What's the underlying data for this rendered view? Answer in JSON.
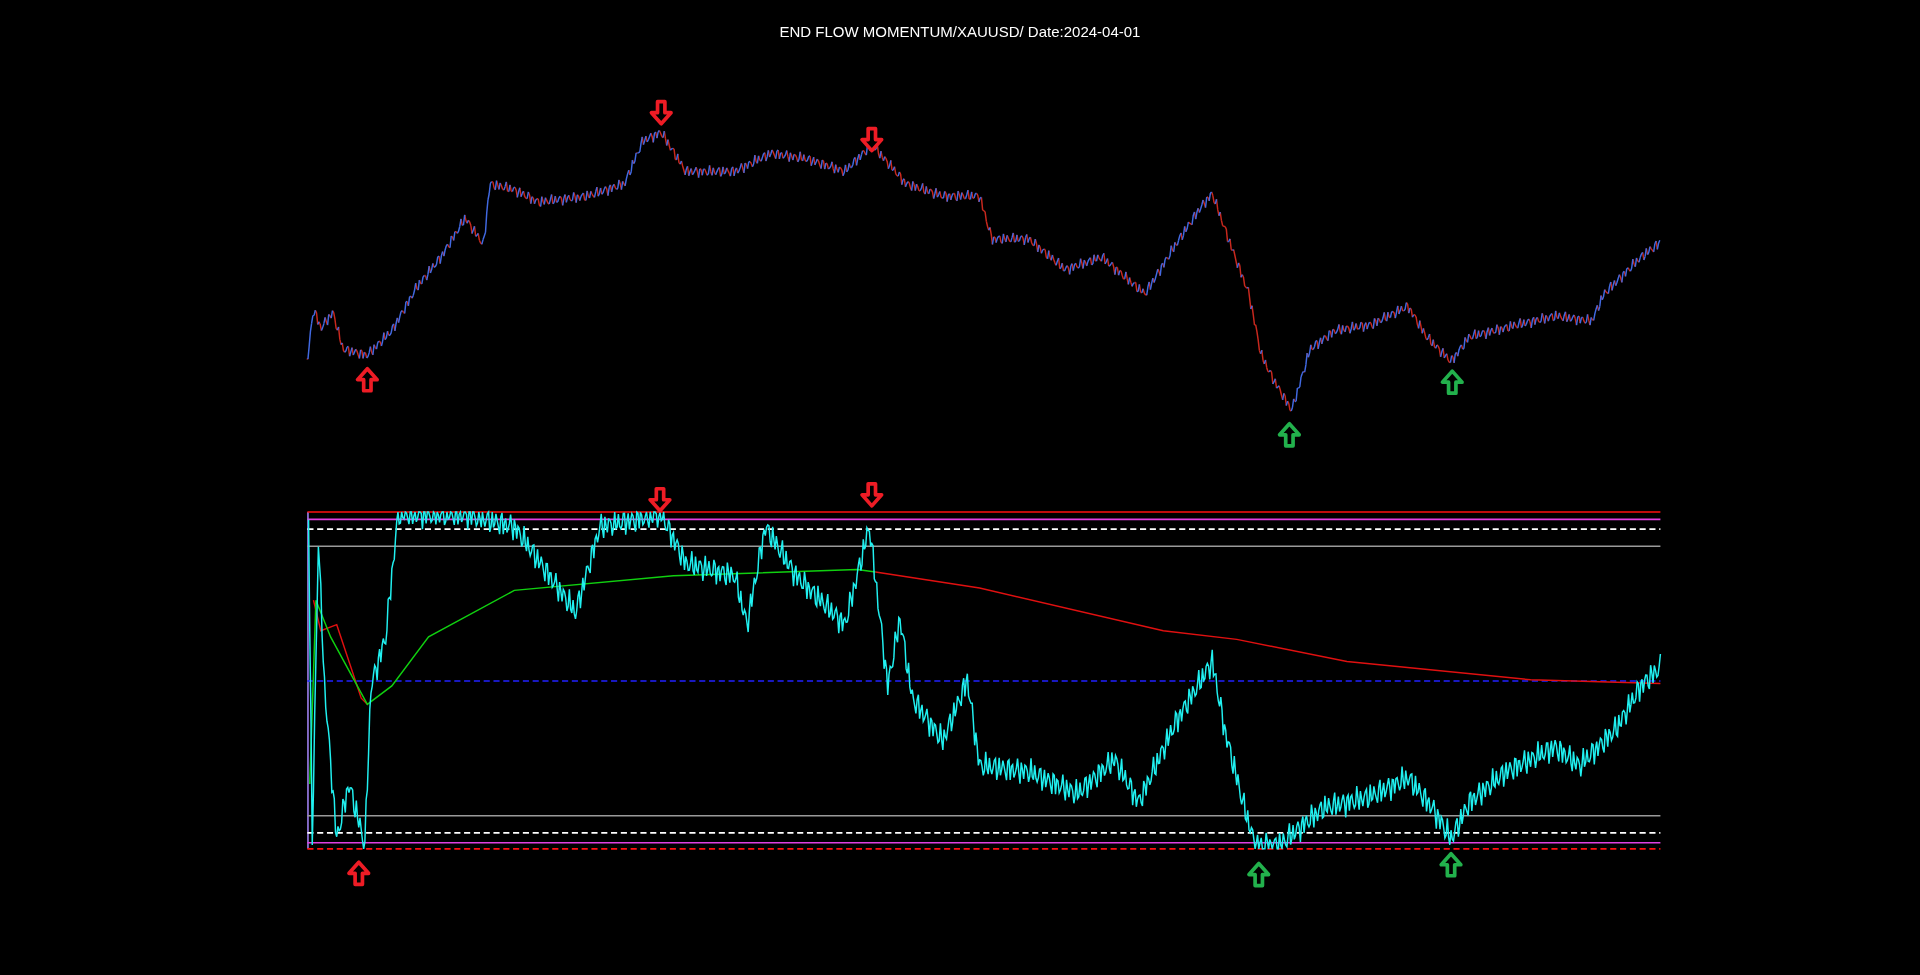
{
  "title": "END FLOW MOMENTUM/XAUUSD/ Date:2024-04-01"
}
